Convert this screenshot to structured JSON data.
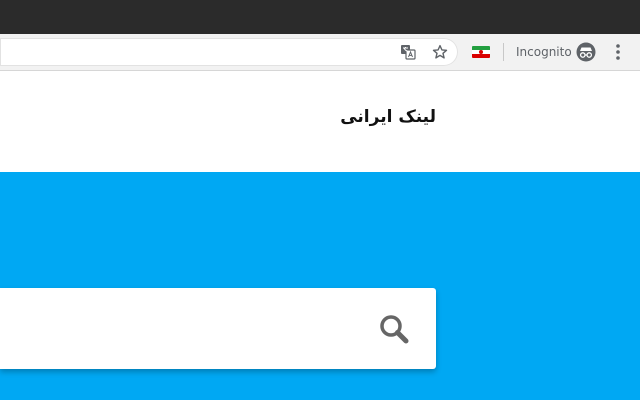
{
  "browser": {
    "incognito_label": "Incognito",
    "icons": {
      "translate": "translate-icon",
      "bookmark": "star-icon",
      "extension": "iran-flag-icon",
      "incognito": "incognito-icon",
      "menu": "kebab-menu-icon"
    }
  },
  "site": {
    "title": "لینک ایرانی"
  },
  "search": {
    "value": "",
    "placeholder": "",
    "icon": "search-icon"
  },
  "colors": {
    "hero_background": "#00a8f3",
    "titlebar": "#2b2b2b",
    "search_icon": "#666666"
  }
}
